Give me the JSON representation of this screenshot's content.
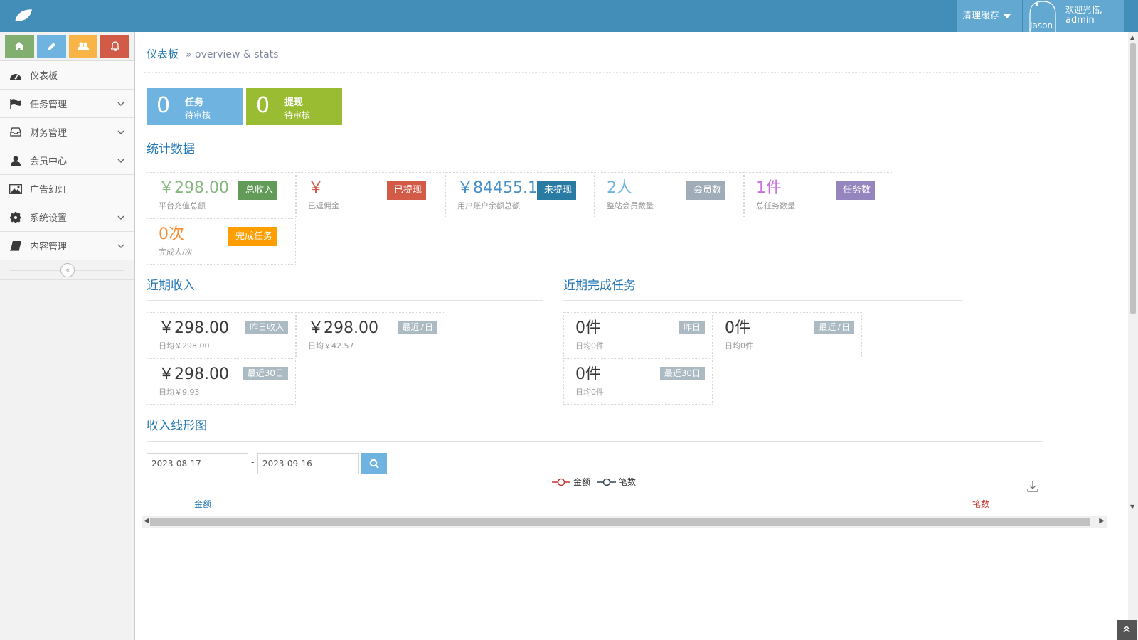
{
  "header": {
    "clear_cache": "清理缓存",
    "welcome": "欢迎光临,",
    "username": "admin",
    "avatar_text": "Jason"
  },
  "sidebar": {
    "shortcut_colors": [
      "#82af6f",
      "#6fb3e0",
      "#f8b446",
      "#d15b47"
    ],
    "items": [
      {
        "label": "仪表板",
        "icon": "dashboard-icon",
        "has_submenu": false
      },
      {
        "label": "任务管理",
        "icon": "flag-icon",
        "has_submenu": true
      },
      {
        "label": "财务管理",
        "icon": "inbox-icon",
        "has_submenu": true
      },
      {
        "label": "会员中心",
        "icon": "user-icon",
        "has_submenu": true
      },
      {
        "label": "广告幻灯",
        "icon": "picture-icon",
        "has_submenu": false
      },
      {
        "label": "系统设置",
        "icon": "cog-icon",
        "has_submenu": true
      },
      {
        "label": "内容管理",
        "icon": "book-icon",
        "has_submenu": true
      }
    ],
    "collapse": "«"
  },
  "breadcrumb": {
    "title": "仪表板",
    "subtitle": "» overview & stats"
  },
  "infoboxes": [
    {
      "num": "0",
      "t1": "任务",
      "t2": "待审核",
      "color": "#6fb3e0"
    },
    {
      "num": "0",
      "t1": "提现",
      "t2": "待审核",
      "color": "#9abc32"
    }
  ],
  "stats_title": "统计数据",
  "stats": [
    {
      "value": "￥298.00",
      "label": "平台充值总额",
      "tag": "总收入",
      "value_color": "#87b87f",
      "tag_color": "#629b58"
    },
    {
      "value": "￥",
      "label": "已返佣金",
      "tag": "已提现",
      "value_color": "#d15b47",
      "tag_color": "#d15b47"
    },
    {
      "value": "￥84455.11",
      "label": "用户账户余额总额",
      "tag": "未提现",
      "value_color": "#478fca",
      "tag_color": "#2a7ba4"
    },
    {
      "value": "2人",
      "label": "整站会员数量",
      "tag": "会员数",
      "value_color": "#6fb3e0",
      "tag_color": "#a0adb8"
    },
    {
      "value": "1件",
      "label": "总任务数量",
      "tag": "任务数",
      "value_color": "#c971e2",
      "tag_color": "#9585bf"
    },
    {
      "value": "0次",
      "label": "完成人/次",
      "tag": "完成任务",
      "value_color": "#ff892a",
      "tag_color": "#ff9e00"
    }
  ],
  "recent_income_title": "近期收入",
  "recent_income": [
    {
      "value": "￥298.00",
      "label": "日均￥298.00",
      "tag": "昨日收入"
    },
    {
      "value": "￥298.00",
      "label": "日均￥42.57",
      "tag": "最近7日"
    },
    {
      "value": "￥298.00",
      "label": "日均￥9.93",
      "tag": "最近30日"
    }
  ],
  "recent_tasks_title": "近期完成任务",
  "recent_tasks": [
    {
      "value": "0件",
      "label": "日均0件",
      "tag": "昨日"
    },
    {
      "value": "0件",
      "label": "日均0件",
      "tag": "最近7日"
    },
    {
      "value": "0件",
      "label": "日均0件",
      "tag": "最近30日"
    }
  ],
  "chart_section": {
    "title": "收入线形图",
    "date_from": "2023-08-17",
    "date_sep": "-",
    "date_to": "2023-09-16",
    "legend": [
      {
        "name": "金额",
        "color": "#c23531"
      },
      {
        "name": "笔数",
        "color": "#2f4554"
      }
    ],
    "axis_left": "金额",
    "axis_right": "笔数"
  }
}
